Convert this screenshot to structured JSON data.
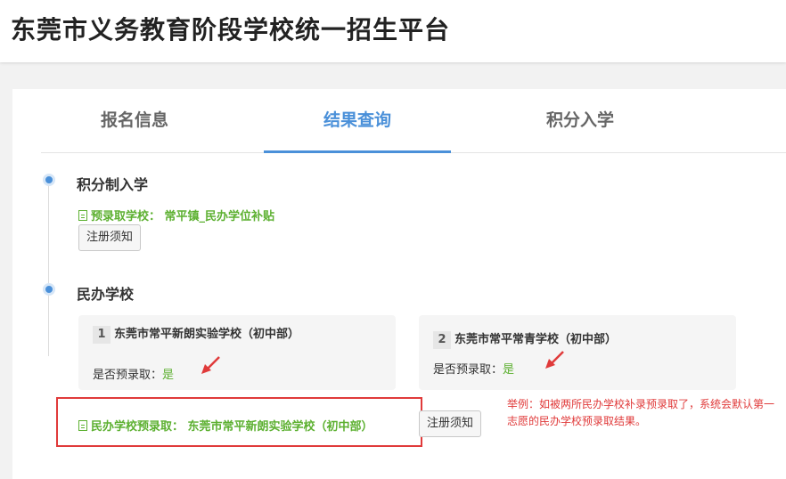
{
  "header": {
    "title": "东莞市义务教育阶段学校统一招生平台"
  },
  "tabs": [
    {
      "label": "报名信息"
    },
    {
      "label": "结果查询"
    },
    {
      "label": "积分入学"
    }
  ],
  "active_tab": "结果查询",
  "points_section": {
    "title": "积分制入学",
    "prefix": "预录取学校：",
    "school": "常平镇_民办学位补贴",
    "notice_button": "注册须知"
  },
  "private_section": {
    "title": "民办学校",
    "cards": [
      {
        "num": "1",
        "name": "东莞市常平新朗实验学校（初中部）",
        "status_label": "是否预录取：",
        "status_value": "是"
      },
      {
        "num": "2",
        "name": "东莞市常平常青学校（初中部）",
        "status_label": "是否预录取：",
        "status_value": "是"
      }
    ],
    "result_prefix": "民办学校预录取：",
    "result_school": "东莞市常平新朗实验学校（初中部）",
    "notice_button": "注册须知"
  },
  "annotation": {
    "note": "举例：如被两所民办学校补录预录取了，系统会默认第一志愿的民办学校预录取结果。"
  },
  "colors": {
    "accent": "#4a90d9",
    "success": "#5cb030",
    "alert": "#e03a3a"
  }
}
